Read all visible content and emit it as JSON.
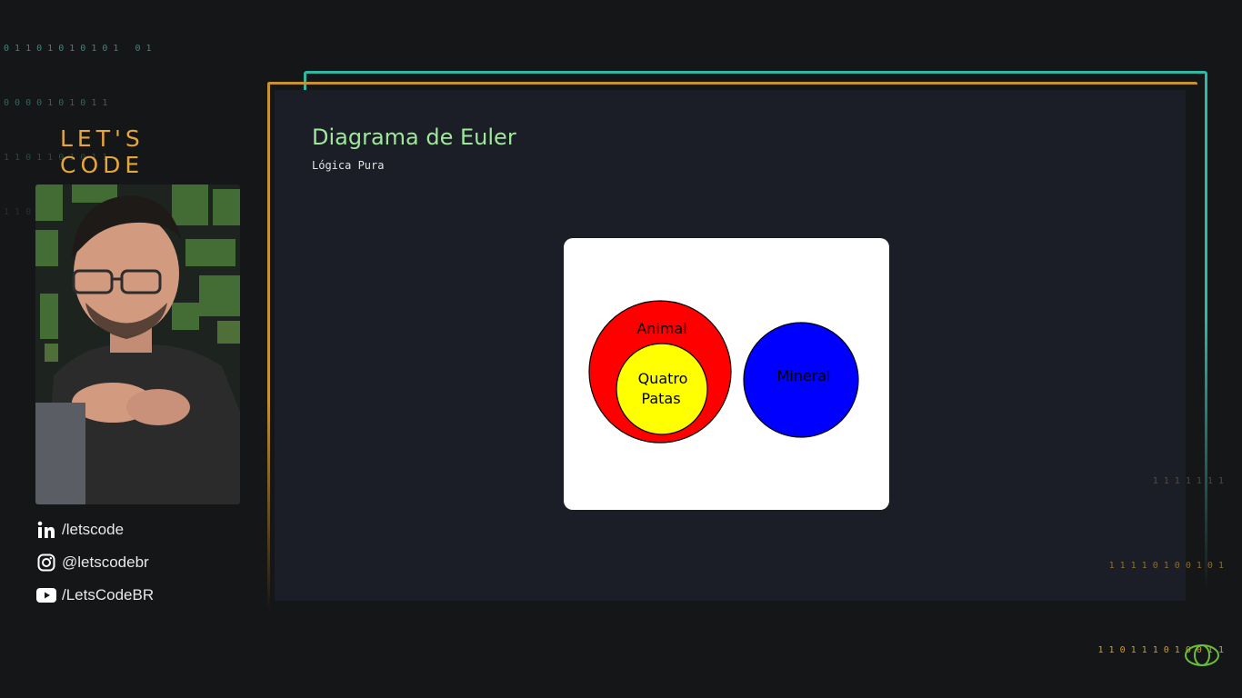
{
  "decor": {
    "binary_top": [
      "0 1 1 0 1 0 1 0 1 0 1   0 1",
      "0 0 0 0 1 0 1 0 1 1",
      "1 1 0 1 1 0 1 0 1 1",
      "1 1 0 0 1 1"
    ],
    "binary_bottom": [
      "1 1 1 1 1 1 1",
      "1 1 1 1 0 1 0 0 1 0 1",
      "1 1 0 1 1 1 0 1 0 0 1 1"
    ]
  },
  "brand": {
    "name": "LET'S CODE",
    "color": "#e7a639"
  },
  "social": [
    {
      "icon": "linkedin-icon",
      "label": "/letscode"
    },
    {
      "icon": "instagram-icon",
      "label": "@letscodebr"
    },
    {
      "icon": "youtube-icon",
      "label": "/LetsCodeBR"
    }
  ],
  "slide": {
    "title": "Diagrama de Euler",
    "subtitle": "Lógica Pura",
    "diagram": {
      "outer_label": "Animal",
      "inner_label_line1": "Quatro",
      "inner_label_line2": "Patas",
      "separate_label": "Mineral",
      "colors": {
        "outer": "#ff0000",
        "inner": "#ffff00",
        "separate": "#0000ff"
      }
    }
  },
  "colors": {
    "accent_gold": "#c7932f",
    "accent_teal": "#2fb8a4",
    "title_green": "#9fe89a"
  }
}
